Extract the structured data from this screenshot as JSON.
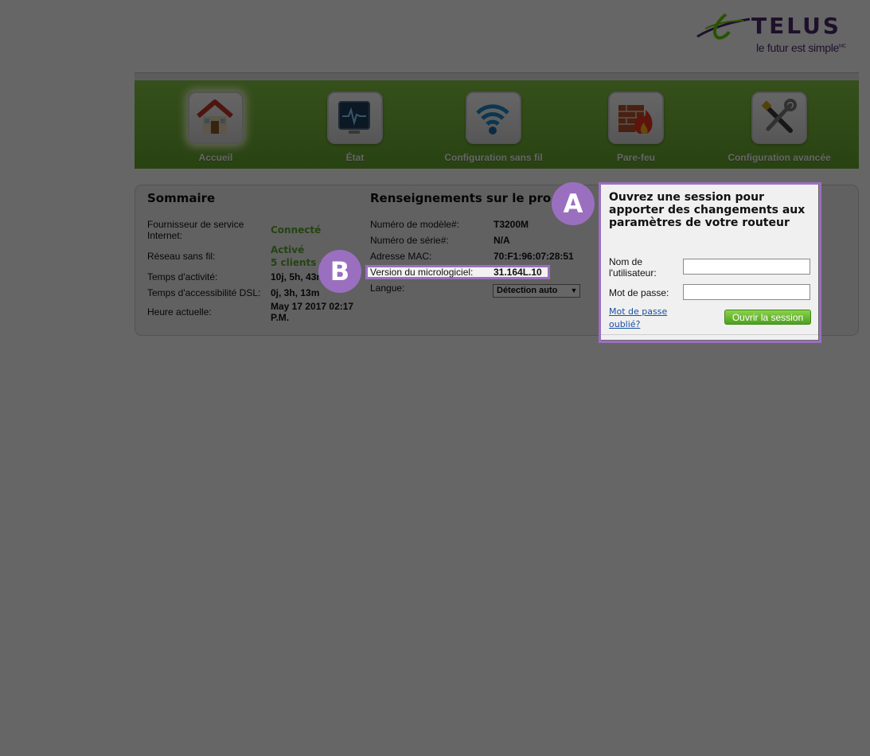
{
  "brand": {
    "name": "TELUS",
    "tagline": "le futur est simple",
    "tagline_mark": "MC",
    "color": "#4b286d",
    "accent": "#66cc00"
  },
  "nav": {
    "items": [
      {
        "label": "Accueil",
        "icon": "house-icon",
        "active": true
      },
      {
        "label": "État",
        "icon": "monitor-icon"
      },
      {
        "label": "Configuration sans fil",
        "icon": "wifi-icon"
      },
      {
        "label": "Pare-feu",
        "icon": "firewall-icon"
      },
      {
        "label": "Configuration avancée",
        "icon": "tools-icon"
      }
    ]
  },
  "summary": {
    "title": "Sommaire",
    "rows": [
      {
        "label": "Fournisseur de service Internet:",
        "value": "Connecté"
      },
      {
        "label": "Réseau sans fil:",
        "value": "Activé",
        "value2": "5 clients c"
      },
      {
        "label": "Temps d'activité:",
        "value": "10j, 5h, 43n"
      },
      {
        "label": "Temps d'accessibilité DSL:",
        "value": "0j, 3h, 13m"
      },
      {
        "label": "Heure actuelle:",
        "value": "May 17 2017 02:17 P.M."
      }
    ]
  },
  "product": {
    "title": "Renseignements sur le produ",
    "rows": [
      {
        "label": "Numéro de modèle#:",
        "value": "T3200M"
      },
      {
        "label": "Numéro de série#:",
        "value": "N/A"
      },
      {
        "label": "Adresse MAC:",
        "value": "70:F1:96:07:28:51"
      },
      {
        "label": "Version du micrologiciel:",
        "value": "31.164L.10"
      },
      {
        "label": "Langue:",
        "value": "Détection auto"
      }
    ]
  },
  "login": {
    "title": "Ouvrez une session pour apporter des changements aux paramètres de votre routeur",
    "username_label": "Nom de l'utilisateur:",
    "username_value": "",
    "password_label": "Mot de passe:",
    "password_value": "",
    "forgot_link": "Mot de passe oublié?",
    "submit": "Ouvrir la session"
  },
  "annotations": {
    "a": "A",
    "b": "B",
    "color": "#9b6fc0"
  }
}
